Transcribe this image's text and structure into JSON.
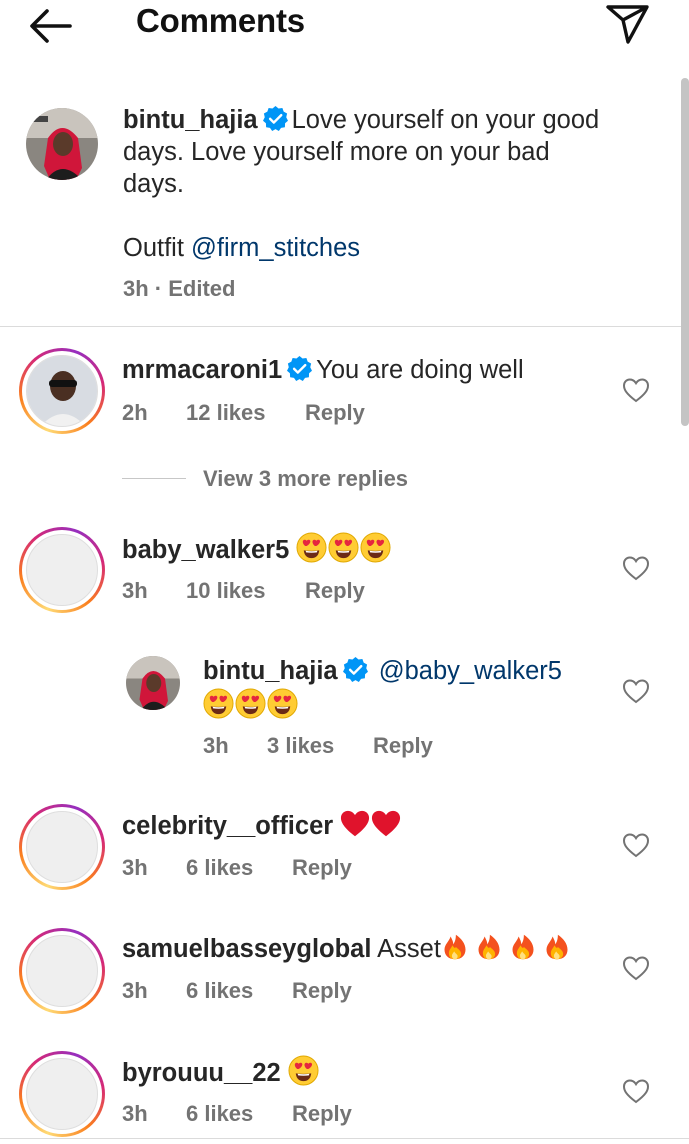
{
  "header": {
    "title": "Comments",
    "back_icon": "arrow-left-icon",
    "send_icon": "paper-plane-icon"
  },
  "caption": {
    "username": "bintu_hajia",
    "verified": true,
    "text_lines": [
      "Love yourself on your good",
      "days. Love yourself more on your bad",
      "days."
    ],
    "outfit_label": "Outfit",
    "mention": "@firm_stitches",
    "meta": "3h · Edited"
  },
  "comments": [
    {
      "username": "mrmacaroni1",
      "verified": true,
      "text": "You are doing well",
      "time": "2h",
      "likes": "12 likes",
      "reply": "Reply"
    },
    {
      "username": "baby_walker5",
      "text": "",
      "emojis": "heart-eyes x3",
      "time": "3h",
      "likes": "10 likes",
      "reply": "Reply"
    },
    {
      "username": "celebrity__officer",
      "emojis": "red-heart x2",
      "time": "3h",
      "likes": "6 likes",
      "reply": "Reply"
    },
    {
      "username": "samuelbasseyglobal",
      "text": "Asset",
      "emojis": "fire x4",
      "time": "3h",
      "likes": "6 likes",
      "reply": "Reply"
    },
    {
      "username": "byrouuu__22",
      "emojis": "heart-eyes x1",
      "time": "3h",
      "likes": "6 likes",
      "reply": "Reply"
    }
  ],
  "view_more": "View 3 more replies",
  "reply_thread": {
    "username": "bintu_hajia",
    "verified": true,
    "mention": "@baby_walker5",
    "emojis": "heart-eyes x3",
    "time": "3h",
    "likes": "3 likes",
    "reply": "Reply"
  },
  "colors": {
    "link": "#00376b",
    "meta": "#737373",
    "verified": "#0095f6",
    "divider": "#dbdbdb"
  }
}
